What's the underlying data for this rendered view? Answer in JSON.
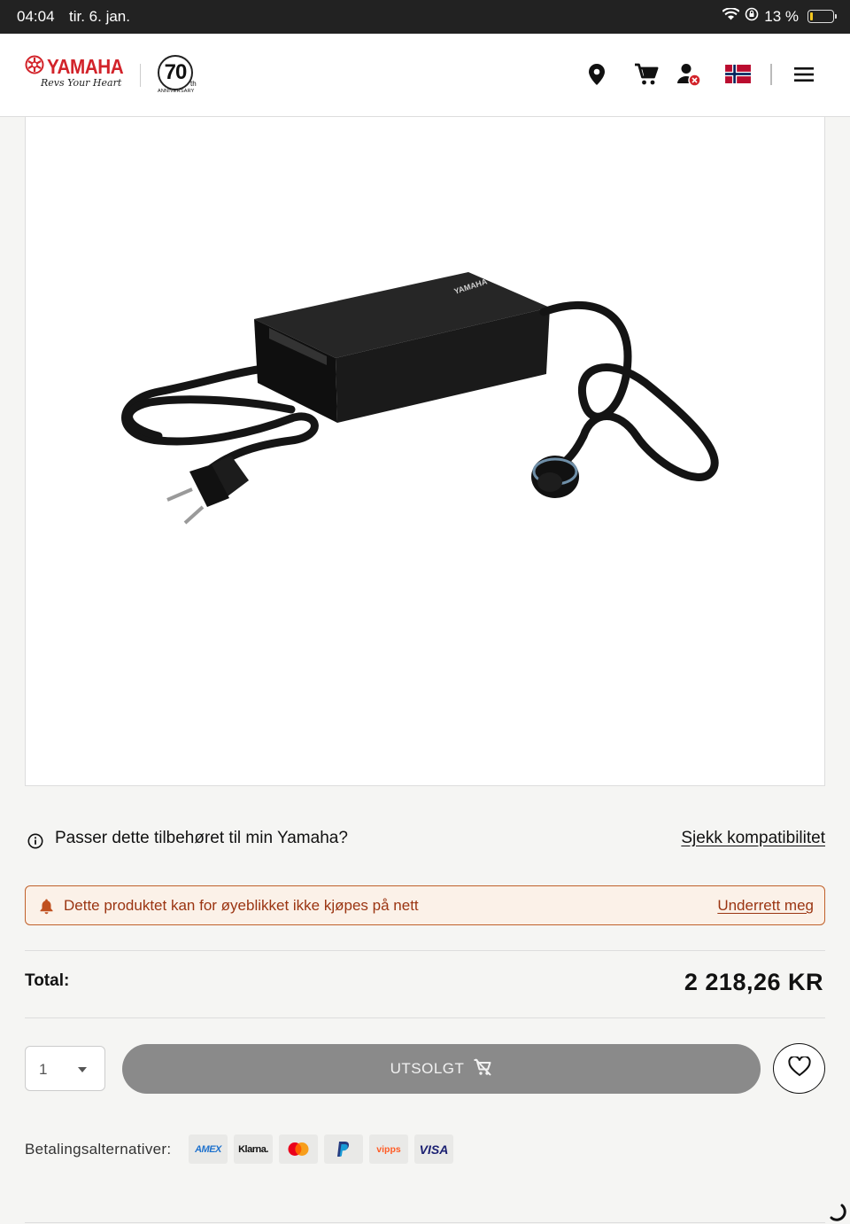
{
  "status_bar": {
    "time": "04:04",
    "date": "tir. 6. jan.",
    "battery": "13 %",
    "battery_level": 0.13,
    "icons": [
      "wifi-icon",
      "orientation-lock-icon",
      "battery-icon"
    ]
  },
  "header": {
    "brand": "YAMAHA",
    "slogan": "Revs Your Heart",
    "anniversary_number": "70",
    "anniversary_suffix": "th",
    "anniversary_label": "ANNIVERSARY",
    "icons": [
      "location-pin-icon",
      "cart-icon",
      "account-icon",
      "norway-flag-icon",
      "menu-icon"
    ]
  },
  "product": {
    "image_alt": "Yamaha battery charger with power cable and connector",
    "charger_label": "YAMAHA"
  },
  "compatibility": {
    "question": "Passer dette tilbehøret til min Yamaha?",
    "link": "Sjekk kompatibilitet"
  },
  "alert": {
    "message": "Dette produktet kan for øyeblikket ikke kjøpes på nett",
    "link": "Underrett meg"
  },
  "total": {
    "label": "Total:",
    "value": "2 218,26 KR"
  },
  "purchase": {
    "quantity": "1",
    "button": "UTSOLGT"
  },
  "payment": {
    "label": "Betalingsalternativer:",
    "methods": [
      "AMEX",
      "Klarna.",
      "Mastercard",
      "PayPal",
      "vipps",
      "VISA"
    ]
  },
  "colors": {
    "brand_red": "#d2232a",
    "alert_border": "#c0602a",
    "alert_text": "#9b3512",
    "soldout_bg": "#8a8a8a"
  }
}
